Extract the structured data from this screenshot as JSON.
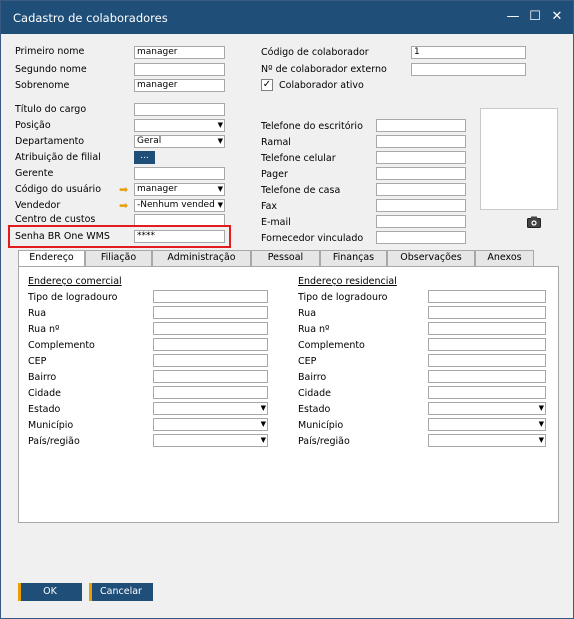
{
  "window": {
    "title": "Cadastro de colaboradores"
  },
  "header": {
    "primeiro_nome": {
      "label": "Primeiro nome",
      "value": "manager"
    },
    "segundo_nome": {
      "label": "Segundo nome",
      "value": ""
    },
    "sobrenome": {
      "label": "Sobrenome",
      "value": "manager"
    },
    "codigo_colaborador": {
      "label": "Código de colaborador",
      "value": "1"
    },
    "num_colaborador_externo": {
      "label": "Nº de colaborador externo",
      "value": ""
    },
    "colaborador_ativo": {
      "label": "Colaborador ativo",
      "checked": true
    }
  },
  "left": {
    "titulo_cargo": {
      "label": "Título do cargo",
      "value": ""
    },
    "posicao": {
      "label": "Posição",
      "value": ""
    },
    "departamento": {
      "label": "Departamento",
      "value": "Geral"
    },
    "atribuicao_filial": {
      "label": "Atribuição de filial",
      "button": "..."
    },
    "gerente": {
      "label": "Gerente",
      "value": ""
    },
    "codigo_usuario": {
      "label": "Código do usuário",
      "value": "manager"
    },
    "vendedor": {
      "label": "Vendedor",
      "value": "-Nenhum vended"
    },
    "centro_custos": {
      "label": "Centro de custos",
      "value": ""
    },
    "senha_wms": {
      "label": "Senha BR One WMS",
      "value": "****"
    }
  },
  "right": {
    "tel_escritorio": {
      "label": "Telefone do escritório",
      "value": ""
    },
    "ramal": {
      "label": "Ramal",
      "value": ""
    },
    "tel_celular": {
      "label": "Telefone celular",
      "value": ""
    },
    "pager": {
      "label": "Pager",
      "value": ""
    },
    "tel_casa": {
      "label": "Telefone de casa",
      "value": ""
    },
    "fax": {
      "label": "Fax",
      "value": ""
    },
    "email": {
      "label": "E-mail",
      "value": ""
    },
    "fornecedor_vinculado": {
      "label": "Fornecedor vinculado",
      "value": ""
    }
  },
  "tabs": [
    "Endereço",
    "Filiação",
    "Administração",
    "Pessoal",
    "Finanças",
    "Observações",
    "Anexos"
  ],
  "address": {
    "comercial_title": "Endereço comercial",
    "residencial_title": "Endereço residencial",
    "fields": [
      "Tipo de logradouro",
      "Rua",
      "Rua nº",
      "Complemento",
      "CEP",
      "Bairro",
      "Cidade",
      "Estado",
      "Município",
      "País/região"
    ]
  },
  "footer": {
    "ok": "OK",
    "cancel": "Cancelar"
  },
  "icons": {
    "camera": "camera-icon",
    "arrow": "link-arrow-icon",
    "minimize": "minimize-icon",
    "maximize": "maximize-icon",
    "close": "close-icon"
  }
}
